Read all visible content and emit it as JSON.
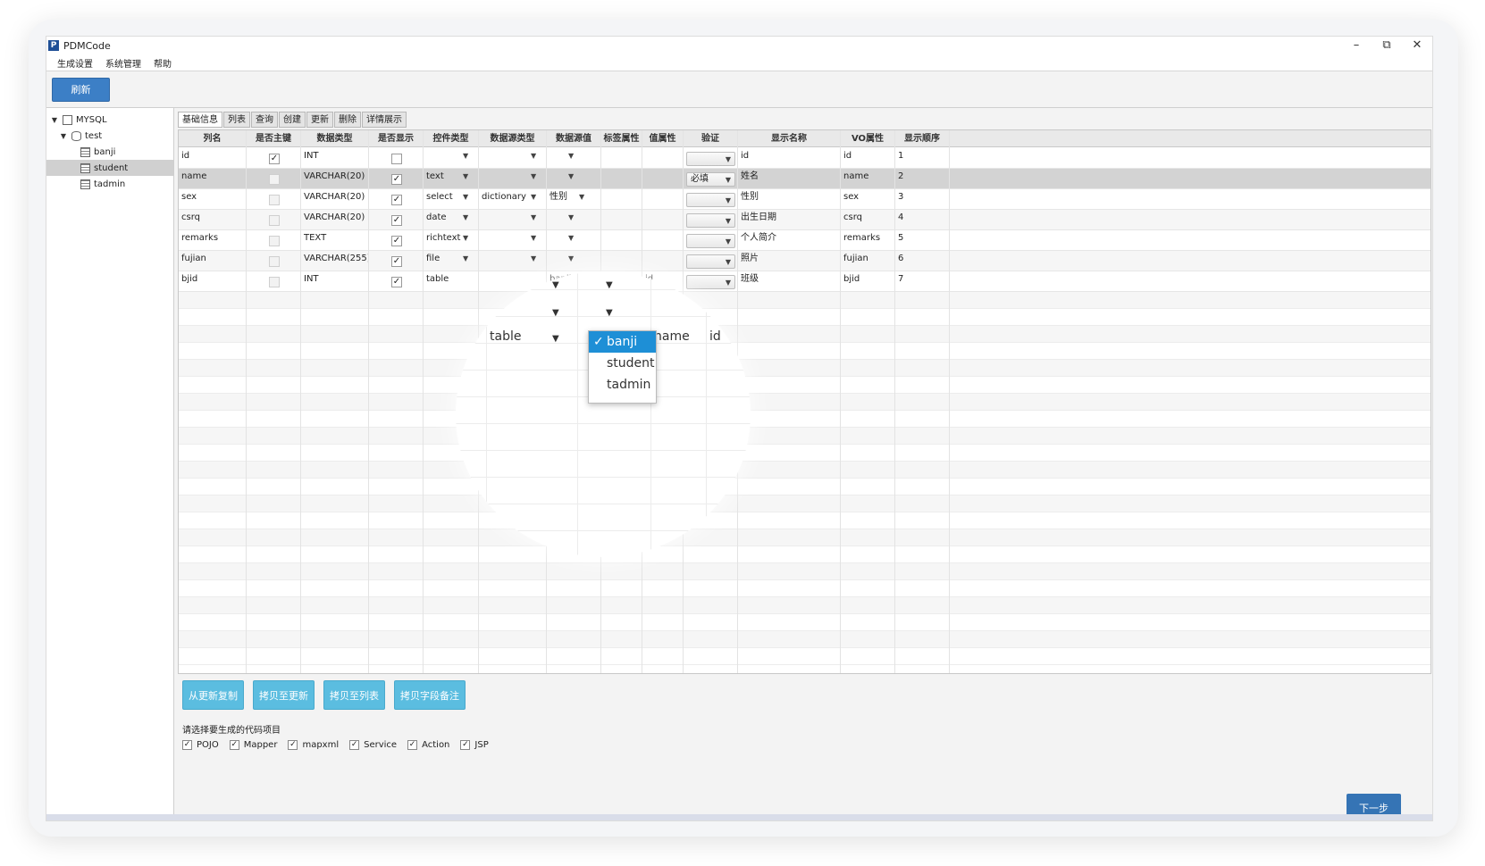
{
  "window": {
    "title": "PDMCode",
    "minimize": "–",
    "restore": "⧉",
    "close": "✕",
    "icon_letter": "P"
  },
  "menu": [
    "生成设置",
    "系统管理",
    "帮助"
  ],
  "toolbar": {
    "refresh_label": "刷新"
  },
  "tree": {
    "root": "MYSQL",
    "db": "test",
    "tables": [
      "banji",
      "student",
      "tadmin"
    ],
    "selected": "student"
  },
  "tabs": [
    "基础信息",
    "列表",
    "查询",
    "创建",
    "更新",
    "删除",
    "详情展示"
  ],
  "columns": [
    "列名",
    "是否主键",
    "数据类型",
    "是否显示",
    "控件类型",
    "数据源类型",
    "数据源值",
    "标签属性",
    "值属性",
    "验证",
    "显示名称",
    "VO属性",
    "显示顺序"
  ],
  "rows": [
    {
      "name": "id",
      "pk": true,
      "type": "INT",
      "show": false,
      "control": "",
      "ds_type": "",
      "ds_value": "",
      "label_attr": "",
      "value_attr": "",
      "validate": "",
      "display": "id",
      "vo": "id",
      "order": "1"
    },
    {
      "name": "name",
      "pk": false,
      "type": "VARCHAR(20)",
      "show": true,
      "control": "text",
      "ds_type": "",
      "ds_value": "",
      "label_attr": "",
      "value_attr": "",
      "validate": "必填",
      "display": "姓名",
      "vo": "name",
      "order": "2"
    },
    {
      "name": "sex",
      "pk": false,
      "type": "VARCHAR(20)",
      "show": true,
      "control": "select",
      "ds_type": "dictionary",
      "ds_value": "性别",
      "label_attr": "",
      "value_attr": "",
      "validate": "",
      "display": "性别",
      "vo": "sex",
      "order": "3"
    },
    {
      "name": "csrq",
      "pk": false,
      "type": "VARCHAR(20)",
      "show": true,
      "control": "date",
      "ds_type": "",
      "ds_value": "",
      "label_attr": "",
      "value_attr": "",
      "validate": "",
      "display": "出生日期",
      "vo": "csrq",
      "order": "4"
    },
    {
      "name": "remarks",
      "pk": false,
      "type": "TEXT",
      "show": true,
      "control": "richtext",
      "ds_type": "",
      "ds_value": "",
      "label_attr": "",
      "value_attr": "",
      "validate": "",
      "display": "个人简介",
      "vo": "remarks",
      "order": "5"
    },
    {
      "name": "fujian",
      "pk": false,
      "type": "VARCHAR(255)",
      "show": true,
      "control": "file",
      "ds_type": "",
      "ds_value": "",
      "label_attr": "",
      "value_attr": "",
      "validate": "",
      "display": "照片",
      "vo": "fujian",
      "order": "6"
    },
    {
      "name": "bjid",
      "pk": false,
      "type": "INT",
      "show": true,
      "control": "table",
      "ds_type": "",
      "ds_value": "banji",
      "label_attr": "name",
      "value_attr": "id",
      "validate": "",
      "display": "班级",
      "vo": "bjid",
      "order": "7"
    }
  ],
  "magnifier": {
    "table_label": "table",
    "label_attr": "name",
    "value_attr": "id",
    "options": [
      "banji",
      "student",
      "tadmin"
    ],
    "selected_option": "banji",
    "check": "✓"
  },
  "actions": [
    "从更新复制",
    "拷贝至更新",
    "拷贝至列表",
    "拷贝字段备注"
  ],
  "generate": {
    "label": "请选择要生成的代码项目",
    "items": [
      "POJO",
      "Mapper",
      "mapxml",
      "Service",
      "Action",
      "JSP"
    ],
    "check": "✓"
  },
  "next_label": "下一步",
  "colors": {
    "accent": "#3c7fc6",
    "action_button": "#5bbde0",
    "dropdown_selected": "#1e8fd6"
  }
}
